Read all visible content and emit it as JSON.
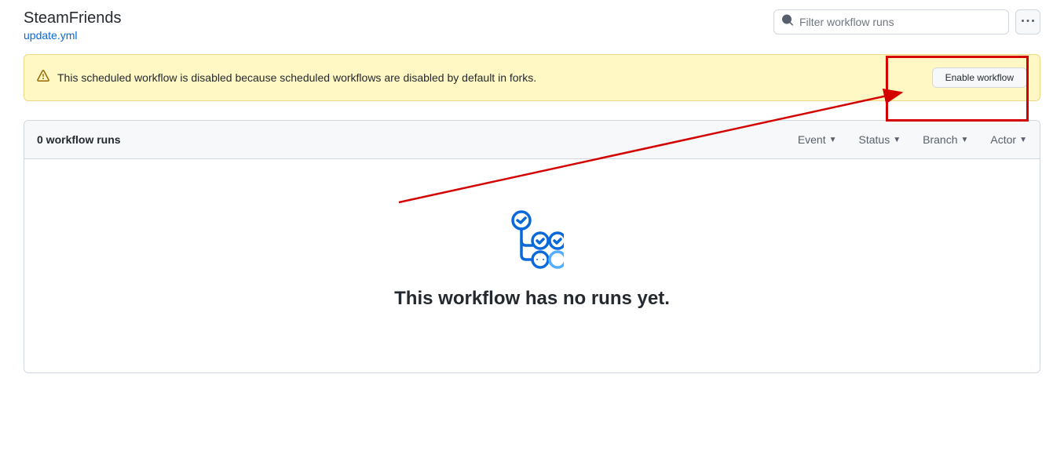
{
  "header": {
    "title": "SteamFriends",
    "yml_link": "update.yml",
    "search_placeholder": "Filter workflow runs"
  },
  "flash": {
    "message": "This scheduled workflow is disabled because scheduled workflows are disabled by default in forks.",
    "enable_label": "Enable workflow"
  },
  "box": {
    "runs_label": "0 workflow runs",
    "filters": [
      "Event",
      "Status",
      "Branch",
      "Actor"
    ],
    "empty_title": "This workflow has no runs yet."
  }
}
